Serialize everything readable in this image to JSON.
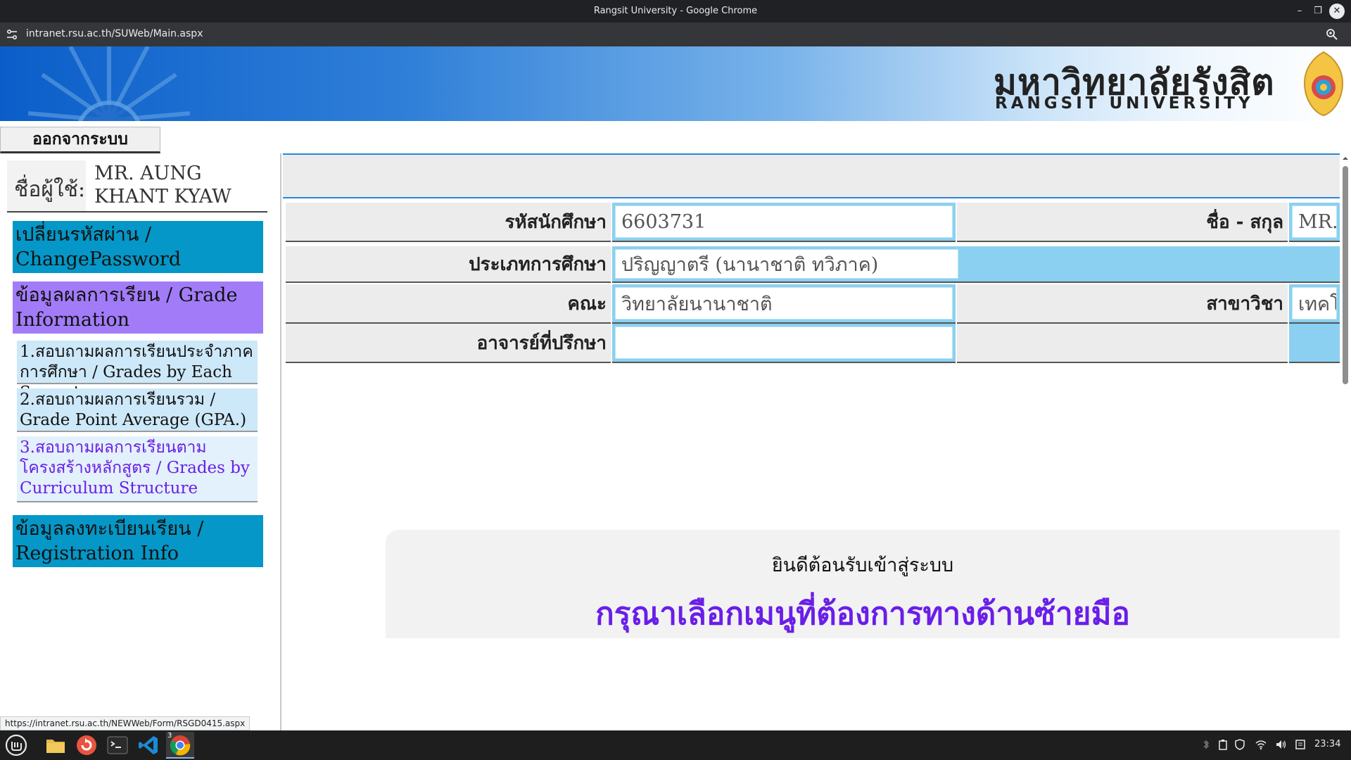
{
  "window": {
    "title": "Rangsit University - Google Chrome"
  },
  "browser": {
    "url": "intranet.rsu.ac.th/SUWeb/Main.aspx",
    "status_url": "https://intranet.rsu.ac.th/NEWWeb/Form/RSGD0415.aspx"
  },
  "banner": {
    "name_th": "มหาวิทยาลัยรังสิต",
    "name_en": "RANGSIT UNIVERSITY"
  },
  "logout_label": "ออกจากระบบ",
  "user": {
    "label": "ชื่อผู้ใช้:",
    "name": "MR. AUNG KHANT KYAW"
  },
  "menu": {
    "change_password": "เปลี่ยนรหัสผ่าน / ChangePassword",
    "grade_info": "ข้อมูลผลการเรียน / Grade Information",
    "sub_items": [
      "1.สอบถามผลการเรียนประจำภาคการศึกษา / Grades by Each Semester",
      "2.สอบถามผลการเรียนรวม / Grade Point Average (GPA.)",
      "3.สอบถามผลการเรียนตามโครงสร้างหลักสูตร / Grades by Curriculum Structure"
    ],
    "registration": "ข้อมูลลงทะเบียนเรียน / Registration Info"
  },
  "student": {
    "id_label": "รหัสนักศึกษา",
    "id_value": "6603731",
    "name_label": "ชื่อ - สกุล",
    "name_value": "MR. A",
    "type_label": "ประเภทการศึกษา",
    "type_value": "ปริญญาตรี (นานาชาติ ทวิภาค)",
    "faculty_label": "คณะ",
    "faculty_value": "วิทยาลัยนานาชาติ",
    "major_label": "สาขาวิชา",
    "major_value": "เทคโน",
    "advisor_label": "อาจารย์ที่ปรึกษา",
    "advisor_value": ""
  },
  "welcome": {
    "line1": "ยินดีต้อนรับเข้าสู่ระบบ",
    "line2": "กรุณาเลือกเมนูที่ต้องการทางด้านซ้ายมือ"
  },
  "taskbar": {
    "clock": "23:34",
    "chrome_badge": "3"
  }
}
